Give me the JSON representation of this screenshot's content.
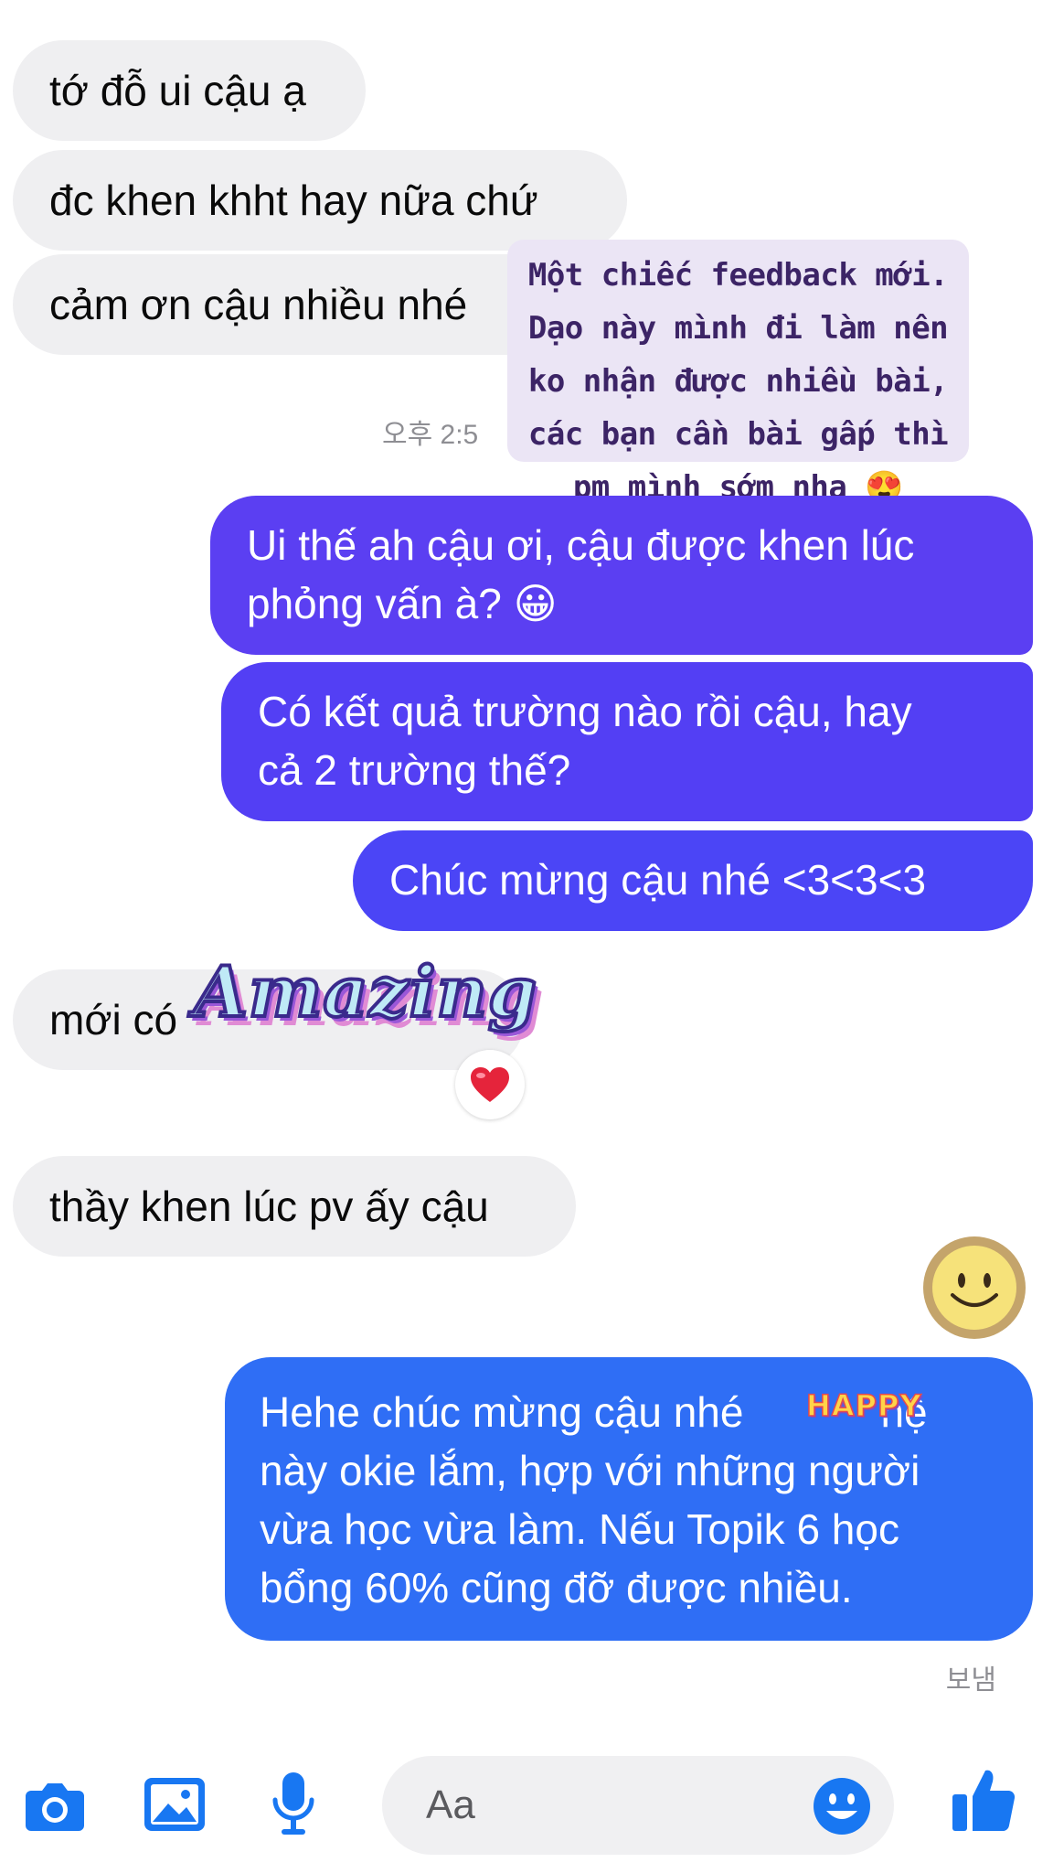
{
  "colors": {
    "incoming_bubble": "#efeff1",
    "outgoing_purple": "#5b3ff2",
    "outgoing_blue": "#2f6ef5",
    "note_bg": "#ebe5f5",
    "icon_blue": "#1877f2"
  },
  "messages": [
    {
      "side": "in",
      "text": "tớ đỗ ui cậu ạ"
    },
    {
      "side": "in",
      "text": "đc khen khht hay nữa chứ"
    },
    {
      "side": "in",
      "text": "cảm ơn cậu nhiều nhé"
    },
    {
      "side": "timestamp",
      "text": "오후 2:5"
    },
    {
      "side": "out",
      "text_line1": "Ui thế ah cậu ơi, cậu được khen lúc",
      "text_line2": "phỏng vấn à? 😀"
    },
    {
      "side": "out",
      "text_line1": "Có kết quả trường nào rồi cậu, hay",
      "text_line2": "cả 2 trường thế?"
    },
    {
      "side": "out",
      "text": "Chúc mừng cậu nhé <3<3<3"
    },
    {
      "side": "in",
      "text": "mới có",
      "sticker_text": "Amazing",
      "reaction": "❤️"
    },
    {
      "side": "in",
      "text": "thầy khen lúc pv ấy cậu"
    },
    {
      "side": "out",
      "lines": [
        "Hehe chúc mừng cậu nhé",
        "này okie lắm, hợp với những người",
        "vừa học vừa làm. Nếu Topik 6 học",
        "bổng 60% cũng đỡ được nhiều."
      ],
      "line1_tail": "hệ",
      "sticker_text": "HAPPY"
    }
  ],
  "overlay_note": {
    "lines": [
      "Một chiếc feedback mới.",
      "Dạo này mình đi làm nên",
      "ko nhận được nhiều bài,",
      "các bạn cần bài gấp thì",
      "pm mình sớm nha 😍"
    ]
  },
  "status": {
    "sent_label": "보냄"
  },
  "composer": {
    "placeholder": "Aa",
    "icons": [
      "camera-icon",
      "image-icon",
      "microphone-icon",
      "emoji-icon",
      "thumbs-up-icon"
    ]
  }
}
